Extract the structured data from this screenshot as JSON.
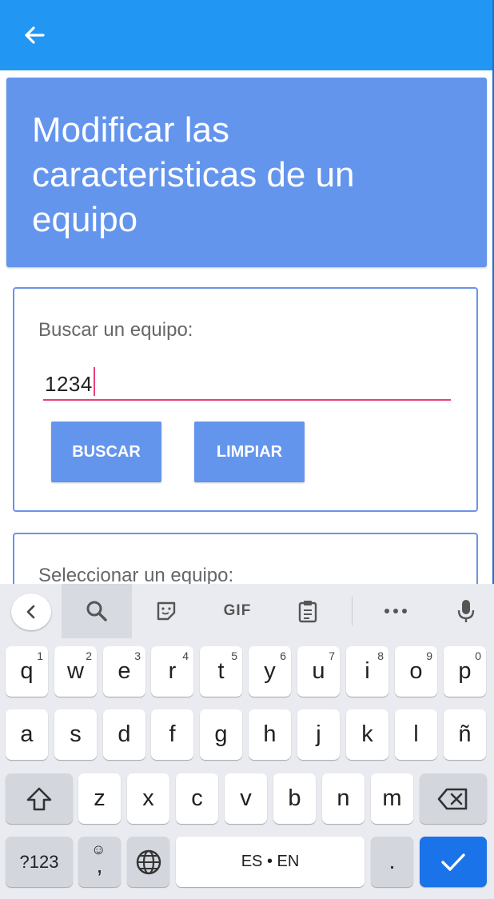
{
  "header": {
    "title": "Modificar las caracteristicas de un equipo"
  },
  "search_card": {
    "label": "Buscar un equipo:",
    "input_value": "1234",
    "buscar_label": "BUSCAR",
    "limpiar_label": "LIMPIAR"
  },
  "select_card": {
    "label": "Seleccionar un equipo:"
  },
  "colors": {
    "appbar": "#2196f3",
    "header_card": "#6495ed",
    "button": "#6495ed",
    "input_underline": "#ec407a",
    "keyboard_bg": "#e9ebf0",
    "enter_key": "#1a73e8"
  },
  "keyboard": {
    "toolbar": {
      "gif_label": "GIF"
    },
    "row1": [
      {
        "key": "q",
        "num": "1"
      },
      {
        "key": "w",
        "num": "2"
      },
      {
        "key": "e",
        "num": "3"
      },
      {
        "key": "r",
        "num": "4"
      },
      {
        "key": "t",
        "num": "5"
      },
      {
        "key": "y",
        "num": "6"
      },
      {
        "key": "u",
        "num": "7"
      },
      {
        "key": "i",
        "num": "8"
      },
      {
        "key": "o",
        "num": "9"
      },
      {
        "key": "p",
        "num": "0"
      }
    ],
    "row2": [
      "a",
      "s",
      "d",
      "f",
      "g",
      "h",
      "j",
      "k",
      "l",
      "ñ"
    ],
    "row3": [
      "z",
      "x",
      "c",
      "v",
      "b",
      "n",
      "m"
    ],
    "row4": {
      "symbols_label": "?123",
      "comma_label": ",",
      "space_label": "ES • EN",
      "period_label": "."
    }
  }
}
